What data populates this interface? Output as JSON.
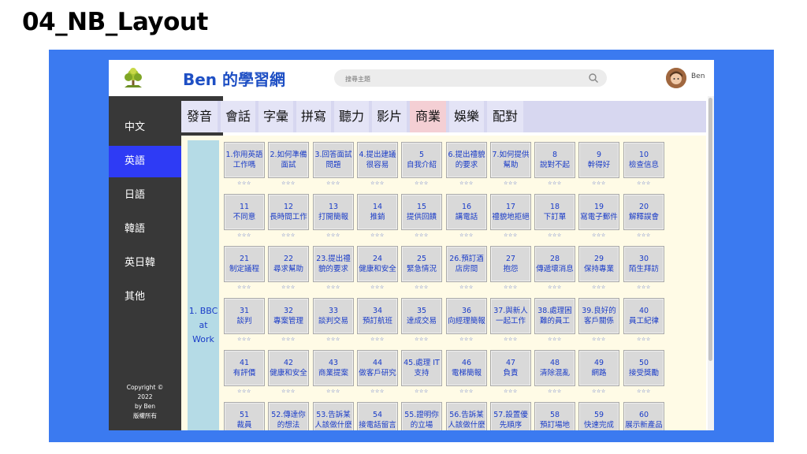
{
  "slide_title": "04_NB_Layout",
  "header": {
    "site_title": "Ben 的學習網",
    "search_placeholder": "搜尋主題",
    "user_name": "Ben"
  },
  "sidebar": {
    "items": [
      {
        "label": "中文"
      },
      {
        "label": "英語",
        "active": true
      },
      {
        "label": "日語"
      },
      {
        "label": "韓語"
      },
      {
        "label": "英日韓"
      },
      {
        "label": "其他"
      }
    ],
    "copyright": [
      "Copyright ©",
      "2022",
      "by Ben",
      "版權所有"
    ]
  },
  "tabs": [
    {
      "label": "發音"
    },
    {
      "label": "會話"
    },
    {
      "label": "字彙"
    },
    {
      "label": "拼寫"
    },
    {
      "label": "聽力"
    },
    {
      "label": "影片"
    },
    {
      "label": "商業",
      "active": true
    },
    {
      "label": "娛樂"
    },
    {
      "label": "配對"
    }
  ],
  "category": {
    "label": [
      "1. BBC",
      "at",
      "Work"
    ]
  },
  "stars": "☆☆☆",
  "lessons": [
    [
      "1.你用英語",
      "工作嗎"
    ],
    [
      "2.如何準備",
      "面試"
    ],
    [
      "3.回答面試",
      "問題"
    ],
    [
      "4.提出建議",
      "很容易"
    ],
    [
      "5",
      "自我介紹"
    ],
    [
      "6.提出禮貌",
      "的要求"
    ],
    [
      "7.如何提供",
      "幫助"
    ],
    [
      "8",
      "說對不起"
    ],
    [
      "9",
      "幹得好"
    ],
    [
      "10",
      "檢查信息"
    ],
    [
      "11",
      "不同意"
    ],
    [
      "12",
      "長時間工作"
    ],
    [
      "13",
      "打開簡報"
    ],
    [
      "14",
      "推銷"
    ],
    [
      "15",
      "提供回饋"
    ],
    [
      "16",
      "講電話"
    ],
    [
      "17",
      "禮貌地拒絕"
    ],
    [
      "18",
      "下訂單"
    ],
    [
      "19",
      "寫電子郵件"
    ],
    [
      "20",
      "解釋誤會"
    ],
    [
      "21",
      "制定議程"
    ],
    [
      "22",
      "尋求幫助"
    ],
    [
      "23.提出禮",
      "貌的要求"
    ],
    [
      "24",
      "健康和安全"
    ],
    [
      "25",
      "緊急情況"
    ],
    [
      "26.預訂酒",
      "店房間"
    ],
    [
      "27",
      "抱怨"
    ],
    [
      "28",
      "傳遞壞消息"
    ],
    [
      "29",
      "保持專業"
    ],
    [
      "30",
      "陌生拜訪"
    ],
    [
      "31",
      "談判"
    ],
    [
      "32",
      "專案管理"
    ],
    [
      "33",
      "談判交易"
    ],
    [
      "34",
      "預訂航班"
    ],
    [
      "35",
      "達成交易"
    ],
    [
      "36",
      "向經理簡報"
    ],
    [
      "37.與新人",
      "一起工作"
    ],
    [
      "38.處理困",
      "難的員工"
    ],
    [
      "39.良好的",
      "客戶關係"
    ],
    [
      "40",
      "員工紀律"
    ],
    [
      "41",
      "有評價"
    ],
    [
      "42",
      "健康和安全"
    ],
    [
      "43",
      "商業提案"
    ],
    [
      "44",
      "做客戶研究"
    ],
    [
      "45.處理 IT",
      "支持"
    ],
    [
      "46",
      "電梯簡報"
    ],
    [
      "47",
      "負責"
    ],
    [
      "48",
      "清除混亂"
    ],
    [
      "49",
      "網路"
    ],
    [
      "50",
      "接受獎勵"
    ],
    [
      "51",
      "裁員"
    ],
    [
      "52.傳達你",
      "的想法"
    ],
    [
      "53.告訴某",
      "人該做什麼"
    ],
    [
      "54",
      "接電話留言"
    ],
    [
      "55.證明你",
      "的立場"
    ],
    [
      "56.告訴某",
      "人該做什麼"
    ],
    [
      "57.設置優",
      "先順序"
    ],
    [
      "58",
      "預訂場地"
    ],
    [
      "59",
      "快速完成"
    ],
    [
      "60",
      "展示新產品"
    ]
  ]
}
